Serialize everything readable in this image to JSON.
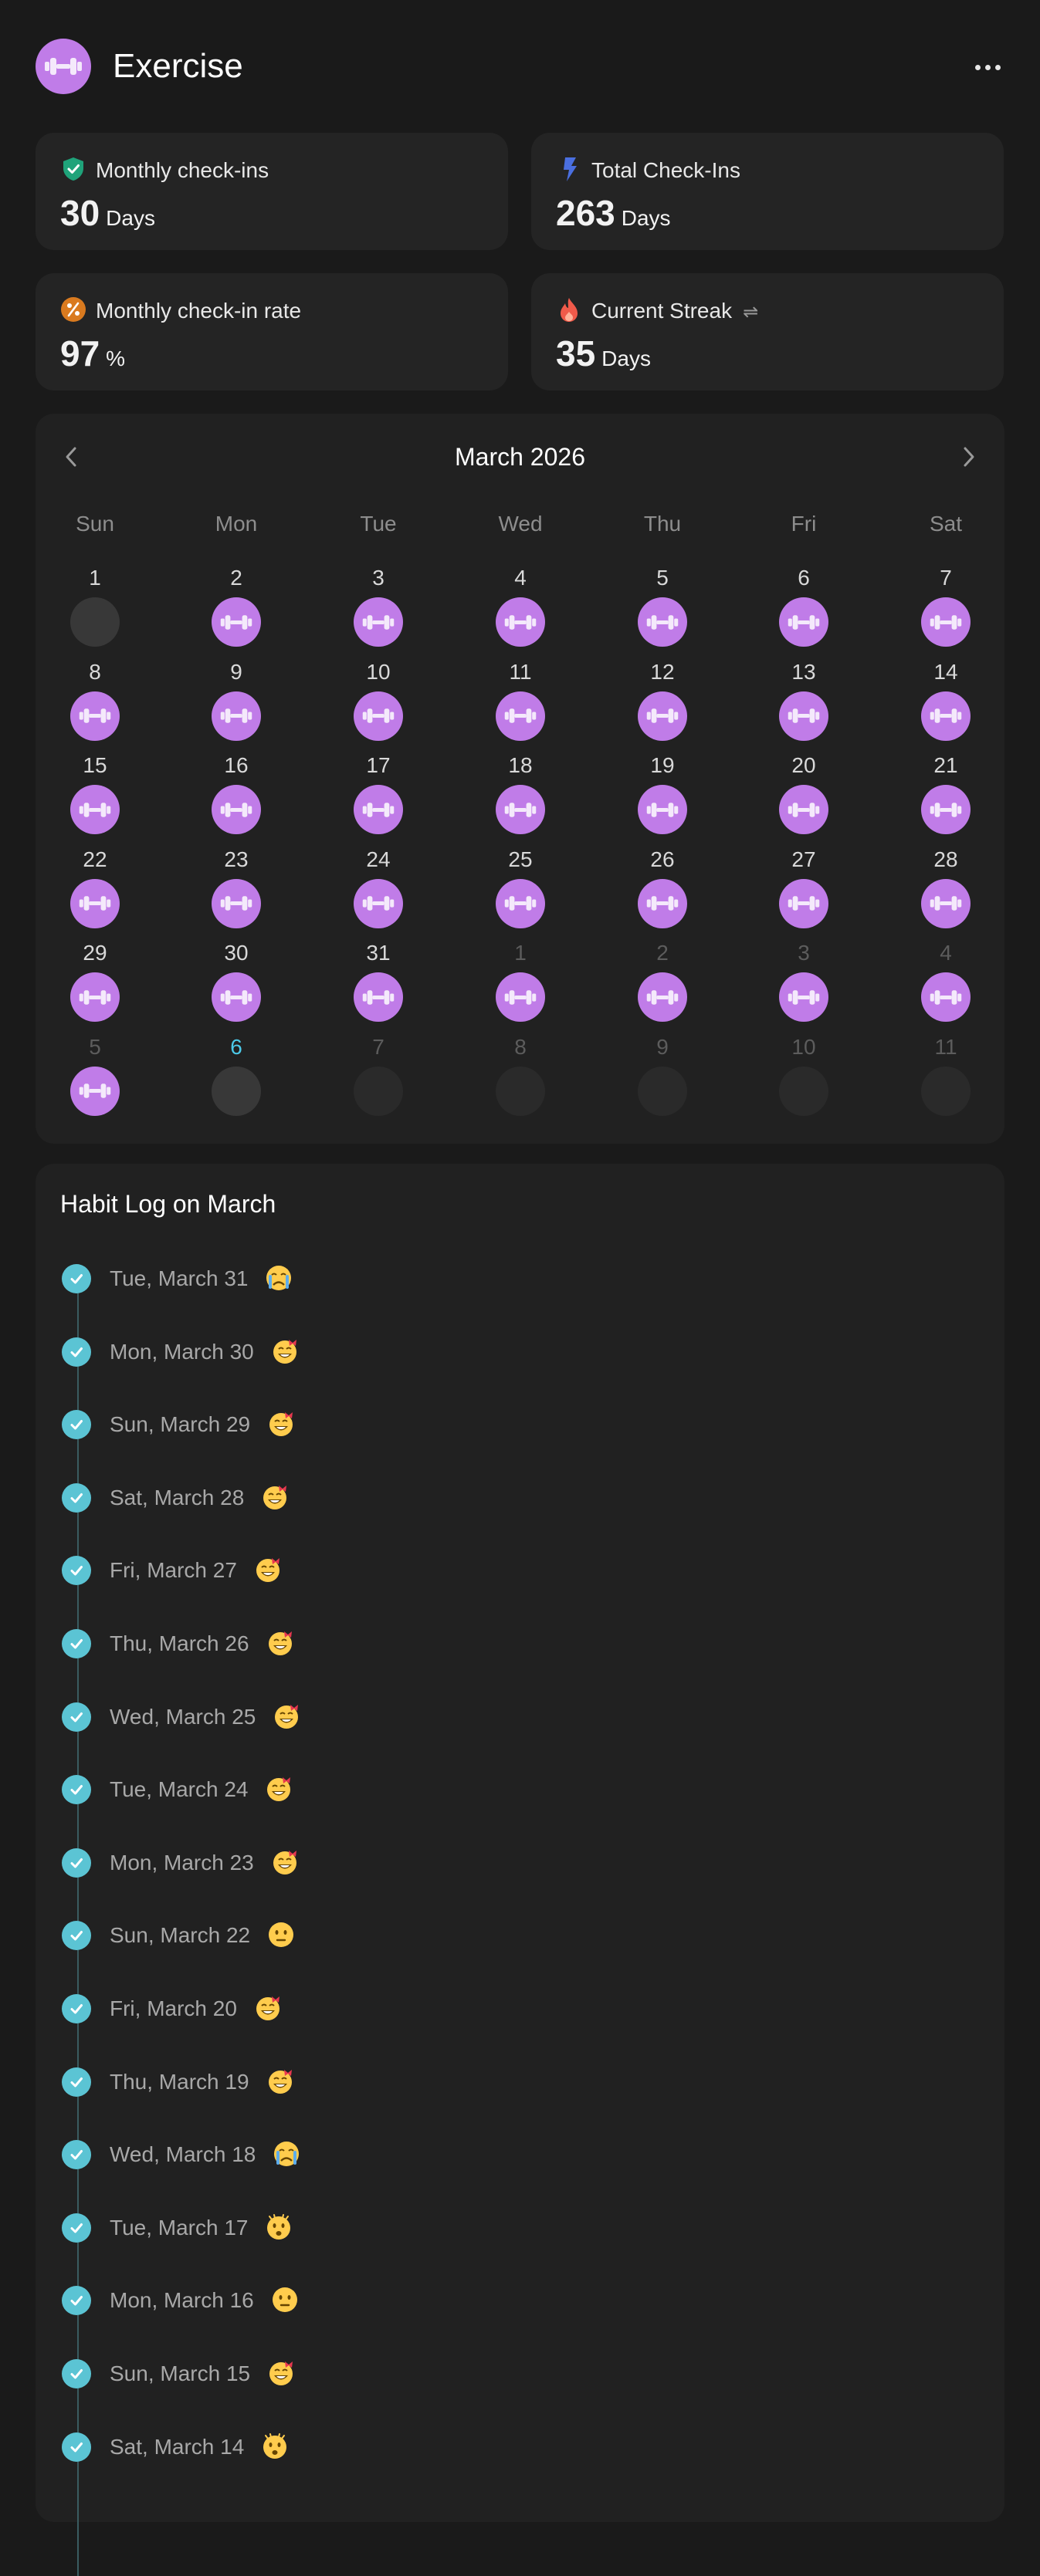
{
  "app": {
    "title": "Exercise",
    "icon": "dumbbell-icon",
    "accent": "#c07ce8"
  },
  "stats": [
    {
      "name": "monthly-checkins",
      "label": "Monthly check-ins",
      "value": "30",
      "unit": "Days",
      "icon": "shield-check-icon",
      "color": "#1fa37a"
    },
    {
      "name": "total-checkins",
      "label": "Total Check-Ins",
      "value": "263",
      "unit": "Days",
      "icon": "lightning-icon",
      "color": "#4a6fe0"
    },
    {
      "name": "monthly-rate",
      "label": "Monthly check-in rate",
      "value": "97",
      "unit": "%",
      "icon": "percent-icon",
      "color": "#d97a1f"
    },
    {
      "name": "current-streak",
      "label": "Current Streak",
      "value": "35",
      "unit": "Days",
      "icon": "flame-icon",
      "color": "#f05a4a",
      "swap": "⇌"
    }
  ],
  "calendar": {
    "title": "March 2026",
    "weekdays": [
      "Sun",
      "Mon",
      "Tue",
      "Wed",
      "Thu",
      "Fri",
      "Sat"
    ],
    "weeks": [
      [
        {
          "d": "1",
          "s": "empty"
        },
        {
          "d": "2",
          "s": "checked"
        },
        {
          "d": "3",
          "s": "checked"
        },
        {
          "d": "4",
          "s": "checked"
        },
        {
          "d": "5",
          "s": "checked"
        },
        {
          "d": "6",
          "s": "checked"
        },
        {
          "d": "7",
          "s": "checked"
        }
      ],
      [
        {
          "d": "8",
          "s": "checked"
        },
        {
          "d": "9",
          "s": "checked"
        },
        {
          "d": "10",
          "s": "checked"
        },
        {
          "d": "11",
          "s": "checked"
        },
        {
          "d": "12",
          "s": "checked"
        },
        {
          "d": "13",
          "s": "checked"
        },
        {
          "d": "14",
          "s": "checked"
        }
      ],
      [
        {
          "d": "15",
          "s": "checked"
        },
        {
          "d": "16",
          "s": "checked"
        },
        {
          "d": "17",
          "s": "checked"
        },
        {
          "d": "18",
          "s": "checked"
        },
        {
          "d": "19",
          "s": "checked"
        },
        {
          "d": "20",
          "s": "checked"
        },
        {
          "d": "21",
          "s": "checked"
        }
      ],
      [
        {
          "d": "22",
          "s": "checked"
        },
        {
          "d": "23",
          "s": "checked"
        },
        {
          "d": "24",
          "s": "checked"
        },
        {
          "d": "25",
          "s": "checked"
        },
        {
          "d": "26",
          "s": "checked"
        },
        {
          "d": "27",
          "s": "checked"
        },
        {
          "d": "28",
          "s": "checked"
        }
      ],
      [
        {
          "d": "29",
          "s": "checked"
        },
        {
          "d": "30",
          "s": "checked"
        },
        {
          "d": "31",
          "s": "checked"
        },
        {
          "d": "1",
          "s": "checked",
          "other": true
        },
        {
          "d": "2",
          "s": "checked",
          "other": true
        },
        {
          "d": "3",
          "s": "checked",
          "other": true
        },
        {
          "d": "4",
          "s": "checked",
          "other": true
        }
      ],
      [
        {
          "d": "5",
          "s": "checked",
          "other": true
        },
        {
          "d": "6",
          "s": "empty",
          "today": true
        },
        {
          "d": "7",
          "s": "future",
          "other": true
        },
        {
          "d": "8",
          "s": "future",
          "other": true
        },
        {
          "d": "9",
          "s": "future",
          "other": true
        },
        {
          "d": "10",
          "s": "future",
          "other": true
        },
        {
          "d": "11",
          "s": "future",
          "other": true
        }
      ]
    ]
  },
  "log": {
    "title": "Habit Log on March",
    "entries": [
      {
        "date": "Tue, March 31",
        "mood": "crying"
      },
      {
        "date": "Mon, March 30",
        "mood": "grin-bow"
      },
      {
        "date": "Sun, March 29",
        "mood": "grin-bow"
      },
      {
        "date": "Sat, March 28",
        "mood": "grin-bow"
      },
      {
        "date": "Fri, March 27",
        "mood": "grin-bow"
      },
      {
        "date": "Thu, March 26",
        "mood": "grin-bow"
      },
      {
        "date": "Wed, March 25",
        "mood": "grin-bow"
      },
      {
        "date": "Tue, March 24",
        "mood": "grin-bow"
      },
      {
        "date": "Mon, March 23",
        "mood": "grin-bow"
      },
      {
        "date": "Sun, March 22",
        "mood": "neutral"
      },
      {
        "date": "Fri, March 20",
        "mood": "grin-bow"
      },
      {
        "date": "Thu, March 19",
        "mood": "grin-bow"
      },
      {
        "date": "Wed, March 18",
        "mood": "crying"
      },
      {
        "date": "Tue, March 17",
        "mood": "surprised"
      },
      {
        "date": "Mon, March 16",
        "mood": "neutral"
      },
      {
        "date": "Sun, March 15",
        "mood": "grin-bow"
      },
      {
        "date": "Sat, March 14",
        "mood": "surprised"
      }
    ]
  }
}
